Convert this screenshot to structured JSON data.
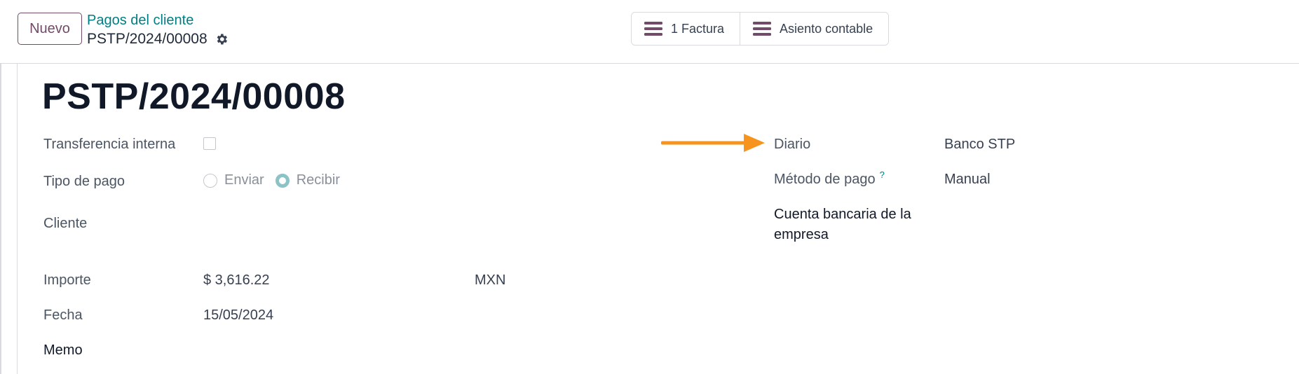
{
  "header": {
    "new_button": "Nuevo",
    "breadcrumb_parent": "Pagos del cliente",
    "breadcrumb_current": "PSTP/2024/00008",
    "smart_buttons": [
      {
        "label": "1 Factura",
        "icon": "bars-icon"
      },
      {
        "label": "Asiento contable",
        "icon": "bars-icon"
      }
    ]
  },
  "form": {
    "title": "PSTP/2024/00008",
    "left": {
      "internal_transfer_label": "Transferencia interna",
      "internal_transfer_checked": false,
      "payment_type_label": "Tipo de pago",
      "payment_type_options": [
        "Enviar",
        "Recibir"
      ],
      "payment_type_selected": "Recibir",
      "customer_label": "Cliente",
      "amount_label": "Importe",
      "amount_value": "$ 3,616.22",
      "currency_value": "MXN",
      "date_label": "Fecha",
      "date_value": "15/05/2024",
      "memo_label": "Memo"
    },
    "right": {
      "journal_label": "Diario",
      "journal_value": "Banco STP",
      "payment_method_label": "Método de pago",
      "payment_method_help": "?",
      "payment_method_value": "Manual",
      "company_bank_label_line1": "Cuenta bancaria de la",
      "company_bank_label_line2": "empresa"
    }
  },
  "colors": {
    "brand": "#714b67",
    "link": "#017e84",
    "annotation_arrow": "#f7941d",
    "radio_checked": "#8cc3c6"
  }
}
